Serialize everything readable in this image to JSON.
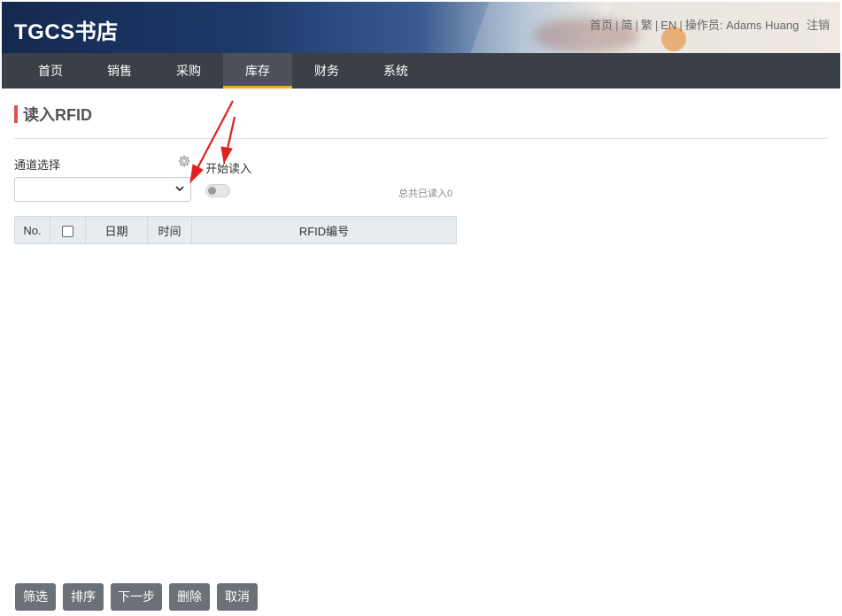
{
  "header": {
    "brand": "TGCS书店",
    "links": {
      "home": "首页",
      "simplified": "简",
      "traditional": "繁",
      "english": "EN",
      "operator_label": "操作员:",
      "operator_name": "Adams Huang",
      "logout": "注销"
    }
  },
  "nav": {
    "items": [
      {
        "label": "首页"
      },
      {
        "label": "销售"
      },
      {
        "label": "采购"
      },
      {
        "label": "库存"
      },
      {
        "label": "财务"
      },
      {
        "label": "系统"
      }
    ],
    "active": "库存"
  },
  "page": {
    "title": "读入RFID"
  },
  "controls": {
    "channel_label": "通道选择",
    "channel_value": "",
    "start_read_label": "开始读入",
    "start_read_on": false,
    "total_read": "总共已读入0"
  },
  "table": {
    "headers": [
      "No.",
      "",
      "日期",
      "时间",
      "RFID编号"
    ],
    "rows": []
  },
  "buttons": {
    "filter": "筛选",
    "sort": "排序",
    "next": "下一步",
    "delete": "删除",
    "cancel": "取消"
  },
  "colors": {
    "nav_bg": "#3b3f46",
    "active_underline": "#f5a623",
    "title_accent": "#d9534f",
    "annotation_arrow": "#e02020",
    "button_bg": "#6c7178"
  }
}
